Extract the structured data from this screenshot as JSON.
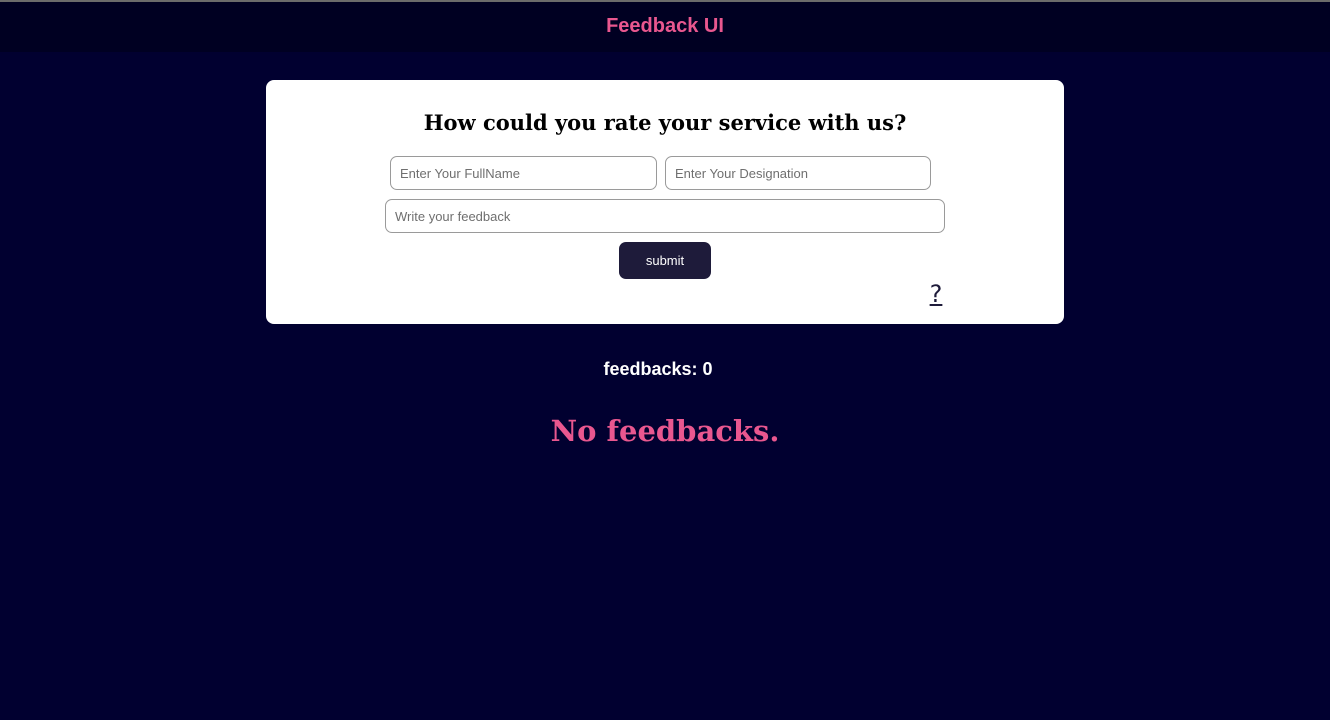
{
  "header": {
    "title": "Feedback UI"
  },
  "form": {
    "question": "How could you rate your service with us?",
    "fullname_placeholder": "Enter Your FullName",
    "fullname_value": "",
    "designation_placeholder": "Enter Your Designation",
    "designation_value": "",
    "feedback_placeholder": "Write your feedback",
    "feedback_value": "",
    "submit_label": "submit",
    "help_label": "?"
  },
  "feedbacks": {
    "count_label": "feedbacks: 0",
    "empty_message": "No feedbacks."
  },
  "colors": {
    "accent": "#e9578f",
    "background": "#010030",
    "header_bg": "#000022",
    "button_bg": "#1e1b3a"
  }
}
